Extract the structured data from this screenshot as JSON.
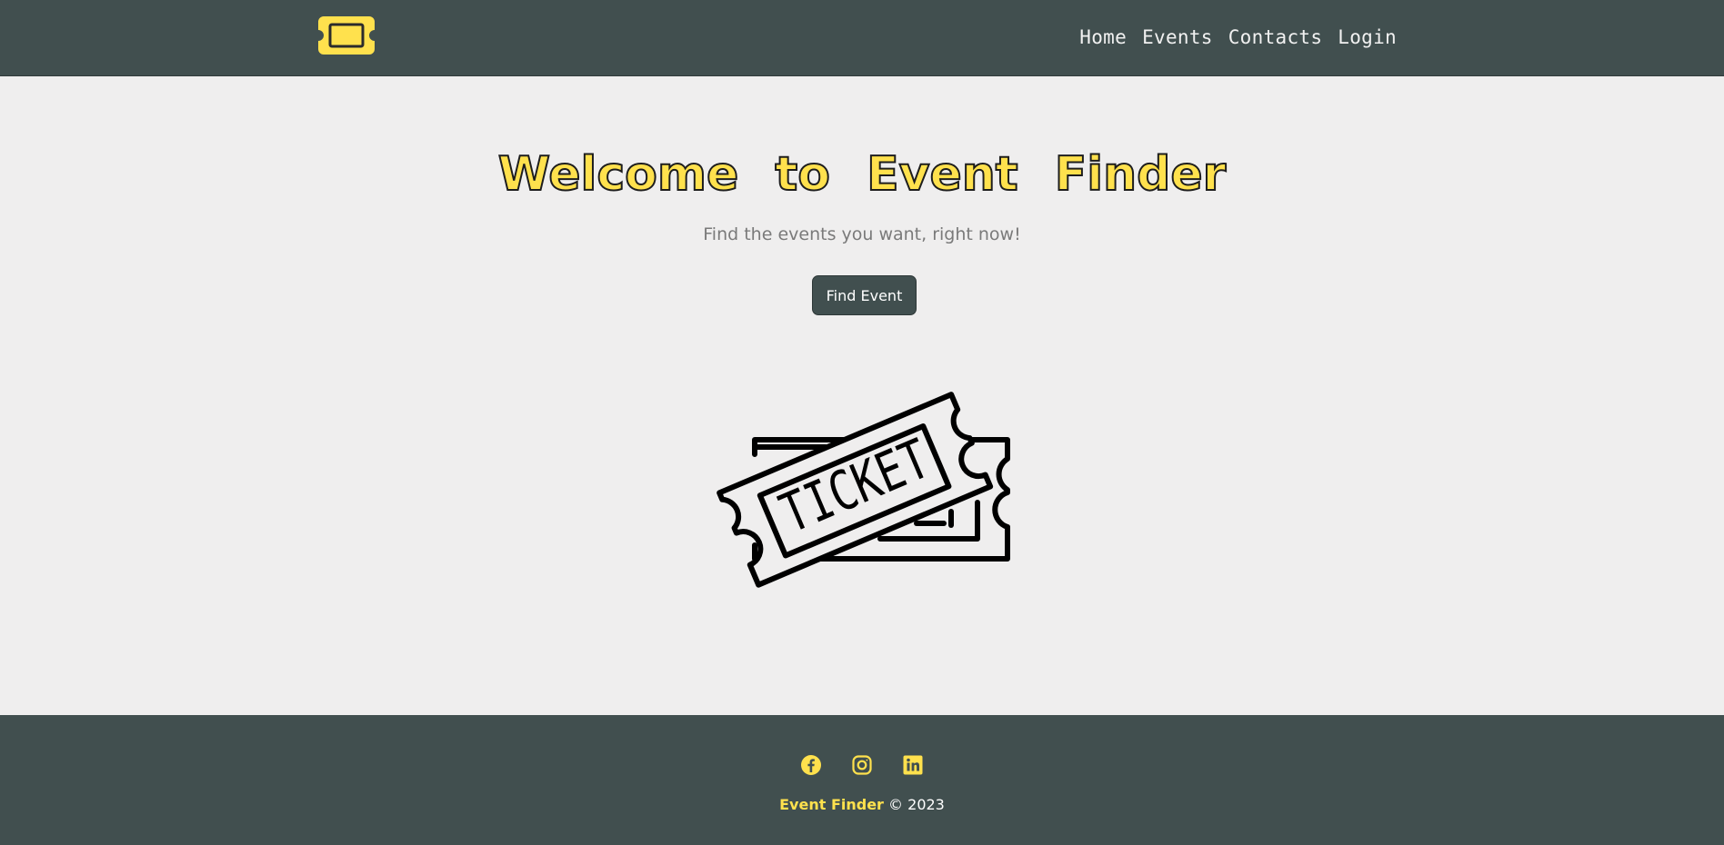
{
  "colors": {
    "header_bg": "#414f4f",
    "page_bg": "#efeeee",
    "accent_yellow": "#ffe14d",
    "text_light": "#f1f1f1",
    "subtitle_gray": "#7a7a7a"
  },
  "header": {
    "logo_icon": "ticket-logo-icon",
    "nav": {
      "home": "Home",
      "events": "Events",
      "contacts": "Contacts",
      "login": "Login"
    }
  },
  "hero": {
    "title": "Welcome to Event Finder",
    "subtitle": "Find the events you want, right now!",
    "cta_label": "Find Event",
    "illustration_text": "TICKET"
  },
  "footer": {
    "social_icons": [
      "facebook-icon",
      "instagram-icon",
      "linkedin-icon"
    ],
    "brand": "Event Finder",
    "copyright": "© 2023"
  }
}
